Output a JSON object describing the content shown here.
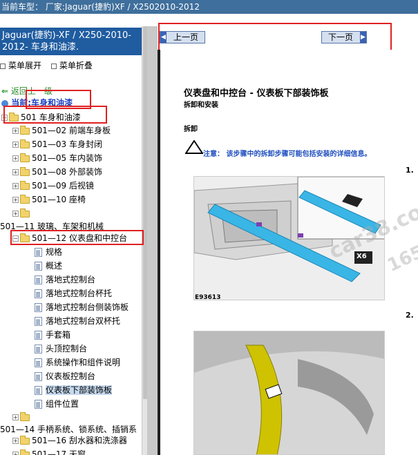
{
  "titlebar": {
    "text": "当前车型： 厂家:Jaguar(捷豹)XF / X2502010-2012"
  },
  "sidebar": {
    "header": "Jaguar(捷豹)-XF / X250-2010-2012- 车身和油漆.",
    "expand_label": "菜单展开",
    "collapse_label": "菜单折叠",
    "back_label": "返回上一级",
    "current_label": "当前:车身和油漆",
    "root_item": "501 车身和油漆",
    "items": [
      {
        "label": "501—02 前端车身板"
      },
      {
        "label": "501—03 车身封闭"
      },
      {
        "label": "501—05 车内装饰"
      },
      {
        "label": "501—08 外部装饰"
      },
      {
        "label": "501—09 后视镜"
      },
      {
        "label": "501—10 座椅"
      },
      {
        "label": ""
      }
    ],
    "glass_item": "501—11 玻璃、车架和机械",
    "expanded_item": "501—12 仪表盘和中控台",
    "children": [
      {
        "label": "规格"
      },
      {
        "label": "概述"
      },
      {
        "label": "落地式控制台"
      },
      {
        "label": "落地式控制台杯托"
      },
      {
        "label": "落地式控制台侧装饰板"
      },
      {
        "label": "落地式控制台双杯托"
      },
      {
        "label": "手套箱"
      },
      {
        "label": "头顶控制台"
      },
      {
        "label": "系统操作和组件说明"
      },
      {
        "label": "仪表板控制台"
      },
      {
        "label": "仪表板下部装饰板"
      },
      {
        "label": "组件位置"
      }
    ],
    "after_items": [
      {
        "label": ""
      },
      {
        "label": "501—14 手柄系统、锁系统、插销系"
      },
      {
        "label": "501—16 刮水器和洗涤器"
      },
      {
        "label": "501—17 天窗"
      }
    ]
  },
  "nav": {
    "prev_label": "上一页",
    "next_label": "下一页"
  },
  "document": {
    "title": "仪表盘和中控台 - 仪表板下部装饰板",
    "subtitle": "拆卸和安装",
    "section": "拆卸",
    "note": "注意： 该步骤中的拆卸步骤可能包括安装的详细信息。",
    "step1": "1.",
    "step2": "2.",
    "fig_code": "E93613",
    "fig_label": "X6"
  }
}
